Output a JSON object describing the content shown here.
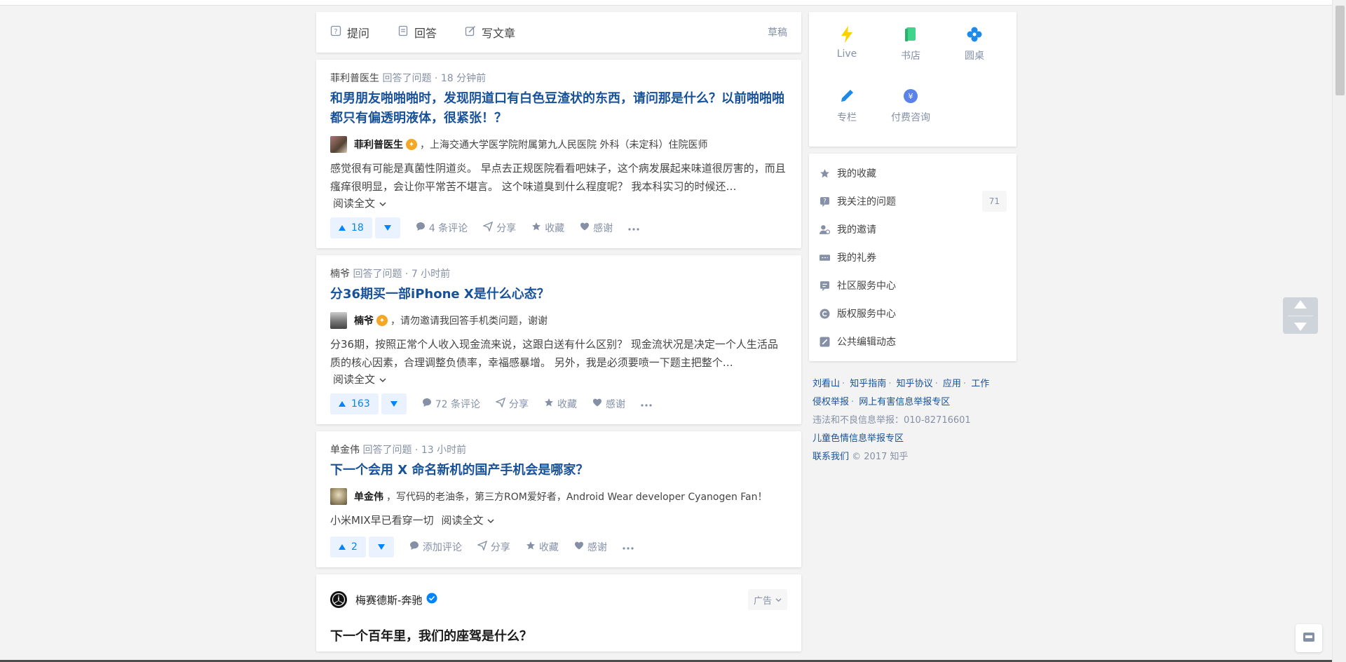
{
  "writebar": {
    "ask_label": "提问",
    "answer_label": "回答",
    "article_label": "写文章",
    "draft_label": "草稿"
  },
  "feeds": [
    {
      "meta_who": "菲利普医生",
      "meta_action": "回答了问题",
      "meta_time": "18 分钟前",
      "title": "和男朋友啪啪啪时，发现阴道口有白色豆渣状的东西，请问那是什么？以前啪啪啪都只有偏透明液体，很紧张！？",
      "author_name": "菲利普医生",
      "author_bio": "，上海交通大学医学院附属第九人民医院 外科（未定科）住院医师",
      "excerpt": "感觉很有可能是真菌性阴道炎。 早点去正规医院看看吧妹子，这个病发展起来味道很厉害的，而且瘙痒很明显，会让你平常苦不堪言。 这个味道臭到什么程度呢？ 我本科实习的时候还…",
      "read_more": "阅读全文",
      "votes": "18",
      "comments": "4 条评论",
      "share": "分享",
      "collect": "收藏",
      "thanks": "感谢"
    },
    {
      "meta_who": "楠爷",
      "meta_action": "回答了问题",
      "meta_time": "7 小时前",
      "title": "分36期买一部iPhone X是什么心态？",
      "author_name": "楠爷",
      "author_bio": "，请勿邀请我回答手机类问题，谢谢",
      "excerpt": "分36期，按照正常个人收入现金流来说，这跟白送有什么区别？ 现金流状况是决定一个人生活品质的核心因素，合理调整负债率，幸福感暴增。 另外，我是必须要喷一下题主把整个…",
      "read_more": "阅读全文",
      "votes": "163",
      "comments": "72 条评论",
      "share": "分享",
      "collect": "收藏",
      "thanks": "感谢"
    },
    {
      "meta_who": "单金伟",
      "meta_action": "回答了问题",
      "meta_time": "13 小时前",
      "title": "下一个会用 X 命名新机的国产手机会是哪家？",
      "author_name": "单金伟",
      "author_bio": "，写代码的老油条，第三方ROM爱好者，Android Wear developer Cyanogen Fan！",
      "excerpt": "小米MIX早已看穿一切",
      "read_more": "阅读全文",
      "votes": "2",
      "comments": "添加评论",
      "share": "分享",
      "collect": "收藏",
      "thanks": "感谢"
    }
  ],
  "ad": {
    "name": "梅赛德斯-奔驰",
    "tag": "广告",
    "title": "下一个百年里，我们的座驾是什么？"
  },
  "side_grid": {
    "live": "Live",
    "bookstore": "书店",
    "roundtable": "圆桌",
    "column": "专栏",
    "consult": "付费咨询"
  },
  "side_menu": {
    "collections": "我的收藏",
    "followed_questions": "我关注的问题",
    "followed_count": "71",
    "invitations": "我的邀请",
    "coupons": "我的礼券",
    "community": "社区服务中心",
    "copyright": "版权服务中心",
    "edit_log": "公共编辑动态"
  },
  "footer": {
    "l1": "刘看山",
    "l2": "知乎指南",
    "l3": "知乎协议",
    "l4": "应用",
    "l5": "工作",
    "l6": "侵权举报",
    "l7": "网上有害信息举报专区",
    "hotline": "违法和不良信息举报：010-82716601",
    "child": "儿童色情信息举报专区",
    "contact": "联系我们",
    "copy": "© 2017 知乎"
  },
  "colors": {
    "link_blue": "#175199",
    "accent": "#0084ff",
    "meta_gray": "#8590a6"
  }
}
